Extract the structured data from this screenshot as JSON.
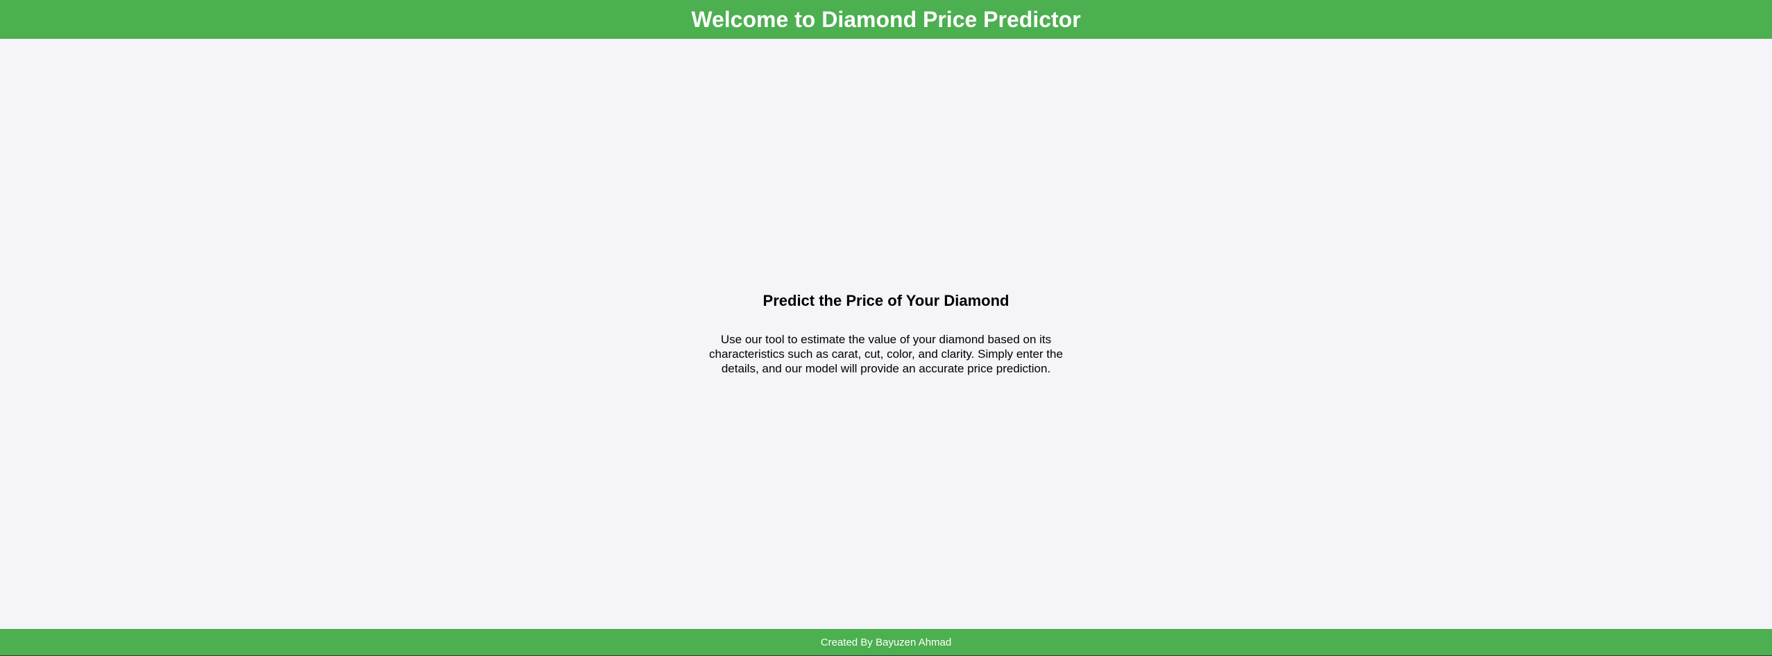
{
  "header": {
    "title": "Welcome to Diamond Price Predictor"
  },
  "main": {
    "heading": "Predict the Price of Your Diamond",
    "description": "Use our tool to estimate the value of your diamond based on its characteristics such as carat, cut, color, and clarity. Simply enter the details, and our model will provide an accurate price prediction."
  },
  "footer": {
    "credit": "Created By Bayuzen Ahmad"
  },
  "colors": {
    "accent": "#4caf50",
    "background": "#f4f4f9",
    "header_text": "#ffffff",
    "body_text": "#000000"
  }
}
